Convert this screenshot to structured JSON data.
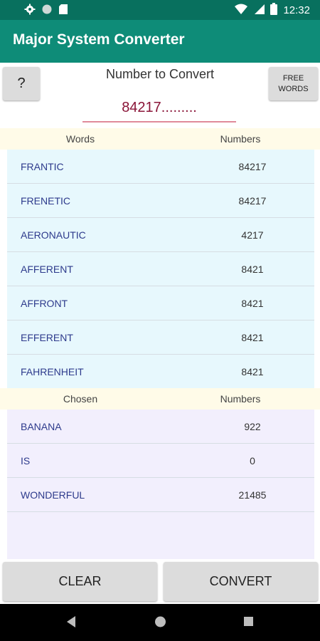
{
  "status_bar": {
    "time": "12:32",
    "icons": [
      "gear-icon",
      "circle-icon",
      "sd-card-icon",
      "wifi-icon",
      "signal-icon",
      "battery-icon"
    ]
  },
  "app_bar": {
    "title": "Major System Converter"
  },
  "controls": {
    "help_label": "?",
    "free_words_label": "FREE\nWORDS",
    "convert_label": "Number to Convert",
    "input_value": "84217........."
  },
  "words_table": {
    "headers": [
      "Words",
      "Numbers"
    ],
    "rows": [
      {
        "word": "FRANTIC",
        "number": "84217"
      },
      {
        "word": "FRENETIC",
        "number": "84217"
      },
      {
        "word": "AERONAUTIC",
        "number": "4217"
      },
      {
        "word": "AFFERENT",
        "number": "8421"
      },
      {
        "word": "AFFRONT",
        "number": "8421"
      },
      {
        "word": "EFFERENT",
        "number": "8421"
      },
      {
        "word": "FAHRENHEIT",
        "number": "8421"
      }
    ]
  },
  "chosen_table": {
    "headers": [
      "Chosen",
      "Numbers"
    ],
    "rows": [
      {
        "word": "BANANA",
        "number": "922"
      },
      {
        "word": "IS",
        "number": "0"
      },
      {
        "word": "WONDERFUL",
        "number": "21485"
      }
    ]
  },
  "buttons": {
    "clear": "CLEAR",
    "convert": "CONVERT"
  },
  "nav_bar": {
    "icons": [
      "back-icon",
      "home-icon",
      "recents-icon"
    ]
  },
  "colors": {
    "status_bar": "#08705e",
    "app_bar": "#0e8c78",
    "words_bg": "#e7f8fd",
    "chosen_bg": "#f2effd",
    "header_bg": "#fffbe8",
    "input_text": "#8a1538",
    "word_text": "#2d3a8c"
  }
}
